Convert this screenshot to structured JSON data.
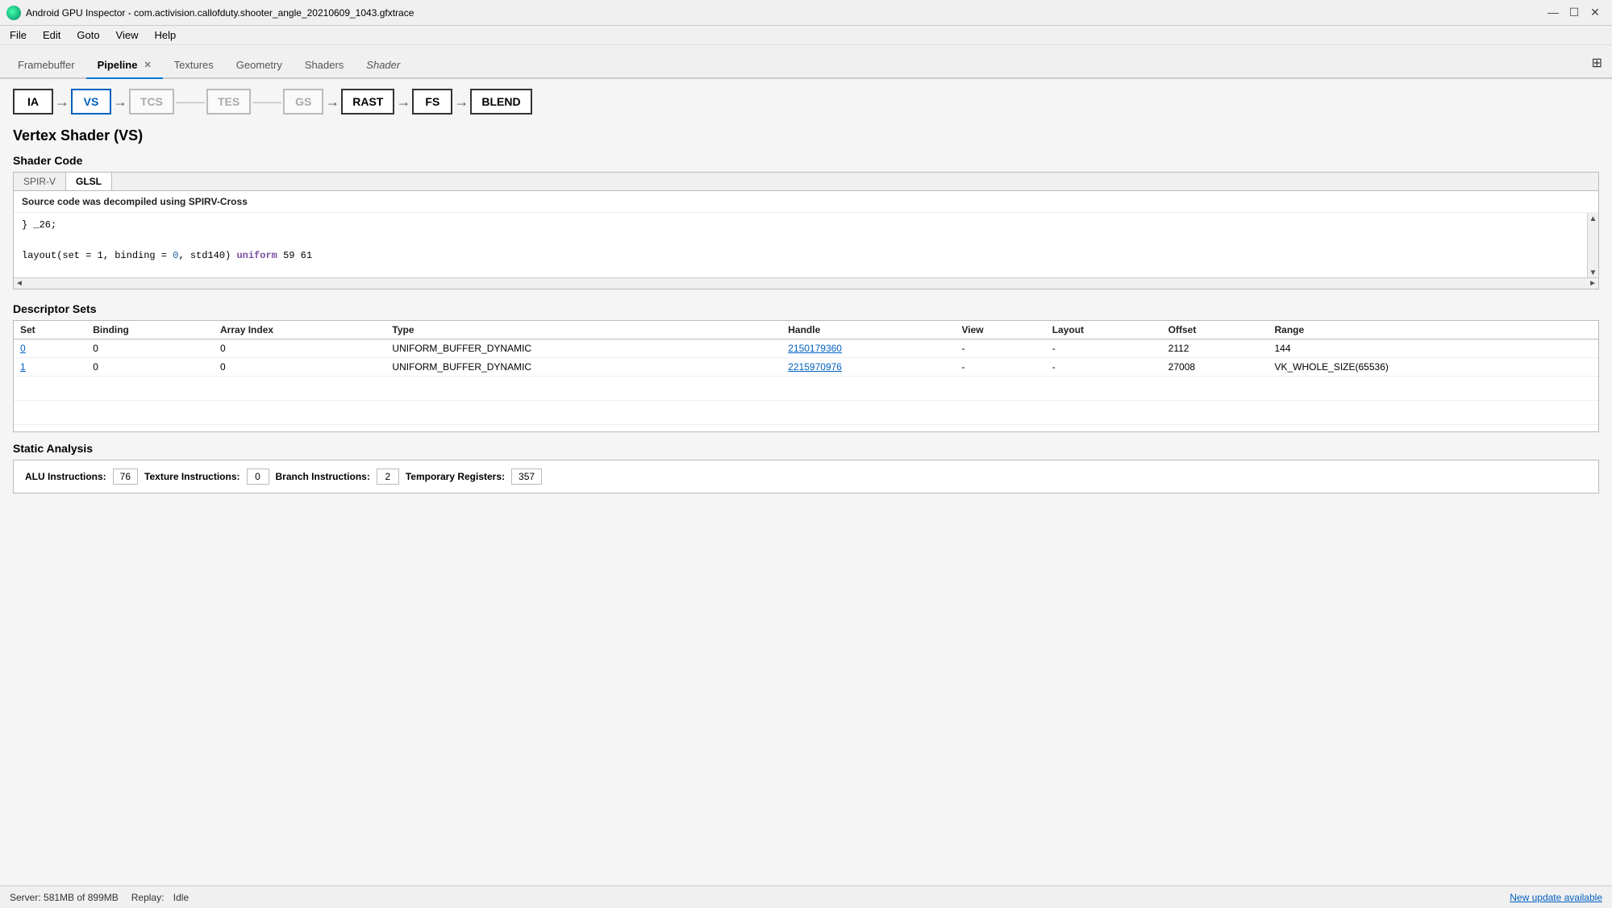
{
  "window": {
    "title": "Android GPU Inspector - com.activision.callofduty.shooter_angle_20210609_1043.gfxtrace",
    "icon": "globe-icon"
  },
  "titlebar_controls": {
    "minimize": "—",
    "maximize": "☐",
    "close": "✕"
  },
  "menubar": {
    "items": [
      "File",
      "Edit",
      "Goto",
      "View",
      "Help"
    ]
  },
  "tabs": [
    {
      "id": "framebuffer",
      "label": "Framebuffer",
      "active": false,
      "italic": false,
      "closeable": false
    },
    {
      "id": "pipeline",
      "label": "Pipeline",
      "active": true,
      "italic": false,
      "closeable": true
    },
    {
      "id": "textures",
      "label": "Textures",
      "active": false,
      "italic": false,
      "closeable": false
    },
    {
      "id": "geometry",
      "label": "Geometry",
      "active": false,
      "italic": false,
      "closeable": false
    },
    {
      "id": "shaders",
      "label": "Shaders",
      "active": false,
      "italic": false,
      "closeable": false
    },
    {
      "id": "shader",
      "label": "Shader",
      "active": false,
      "italic": true,
      "closeable": false
    }
  ],
  "pipeline_nodes": [
    {
      "id": "ia",
      "label": "IA",
      "active": false,
      "dimmed": false
    },
    {
      "id": "vs",
      "label": "VS",
      "active": true,
      "dimmed": false
    },
    {
      "id": "tcs",
      "label": "TCS",
      "active": false,
      "dimmed": true
    },
    {
      "id": "tes",
      "label": "TES",
      "active": false,
      "dimmed": true
    },
    {
      "id": "gs",
      "label": "GS",
      "active": false,
      "dimmed": true
    },
    {
      "id": "rast",
      "label": "RAST",
      "active": false,
      "dimmed": false
    },
    {
      "id": "fs",
      "label": "FS",
      "active": false,
      "dimmed": false
    },
    {
      "id": "blend",
      "label": "BLEND",
      "active": false,
      "dimmed": false
    }
  ],
  "section": {
    "title": "Vertex Shader (VS)"
  },
  "shader_code": {
    "title": "Shader Code",
    "tabs": [
      "SPIR-V",
      "GLSL"
    ],
    "active_tab": "GLSL",
    "decompile_note": "Source code was decompiled using SPIRV-Cross",
    "lines": [
      {
        "text": "} _26;",
        "plain": true
      },
      {
        "text": "",
        "plain": true
      },
      {
        "text": "layout(set = 1, binding = 0, std140) uniform 59 61",
        "has_keyword": true,
        "keyword": "uniform",
        "before_keyword": "layout(set = 1, binding = 0, std140) ",
        "after_keyword": " 59 61"
      }
    ]
  },
  "descriptor_sets": {
    "title": "Descriptor Sets",
    "columns": [
      "Set",
      "Binding",
      "Array Index",
      "Type",
      "Handle",
      "View",
      "Layout",
      "Offset",
      "Range"
    ],
    "rows": [
      {
        "set": "0",
        "set_link": true,
        "binding": "0",
        "array_index": "0",
        "type": "UNIFORM_BUFFER_DYNAMIC",
        "handle": "2150179360",
        "handle_link": true,
        "view": "-",
        "layout": "-",
        "offset": "2112",
        "range": "144"
      },
      {
        "set": "1",
        "set_link": true,
        "binding": "0",
        "array_index": "0",
        "type": "UNIFORM_BUFFER_DYNAMIC",
        "handle": "2215970976",
        "handle_link": true,
        "view": "-",
        "layout": "-",
        "offset": "27008",
        "range": "VK_WHOLE_SIZE(65536)"
      }
    ]
  },
  "static_analysis": {
    "title": "Static Analysis",
    "stats": [
      {
        "label": "ALU Instructions:",
        "value": "76"
      },
      {
        "label": "Texture Instructions:",
        "value": "0"
      },
      {
        "label": "Branch Instructions:",
        "value": "2"
      },
      {
        "label": "Temporary Registers:",
        "value": "357"
      }
    ]
  },
  "statusbar": {
    "server_label": "Server:",
    "server_memory": "581MB of 899MB",
    "replay_label": "Replay:",
    "replay_status": "Idle",
    "update_link": "New update available"
  }
}
